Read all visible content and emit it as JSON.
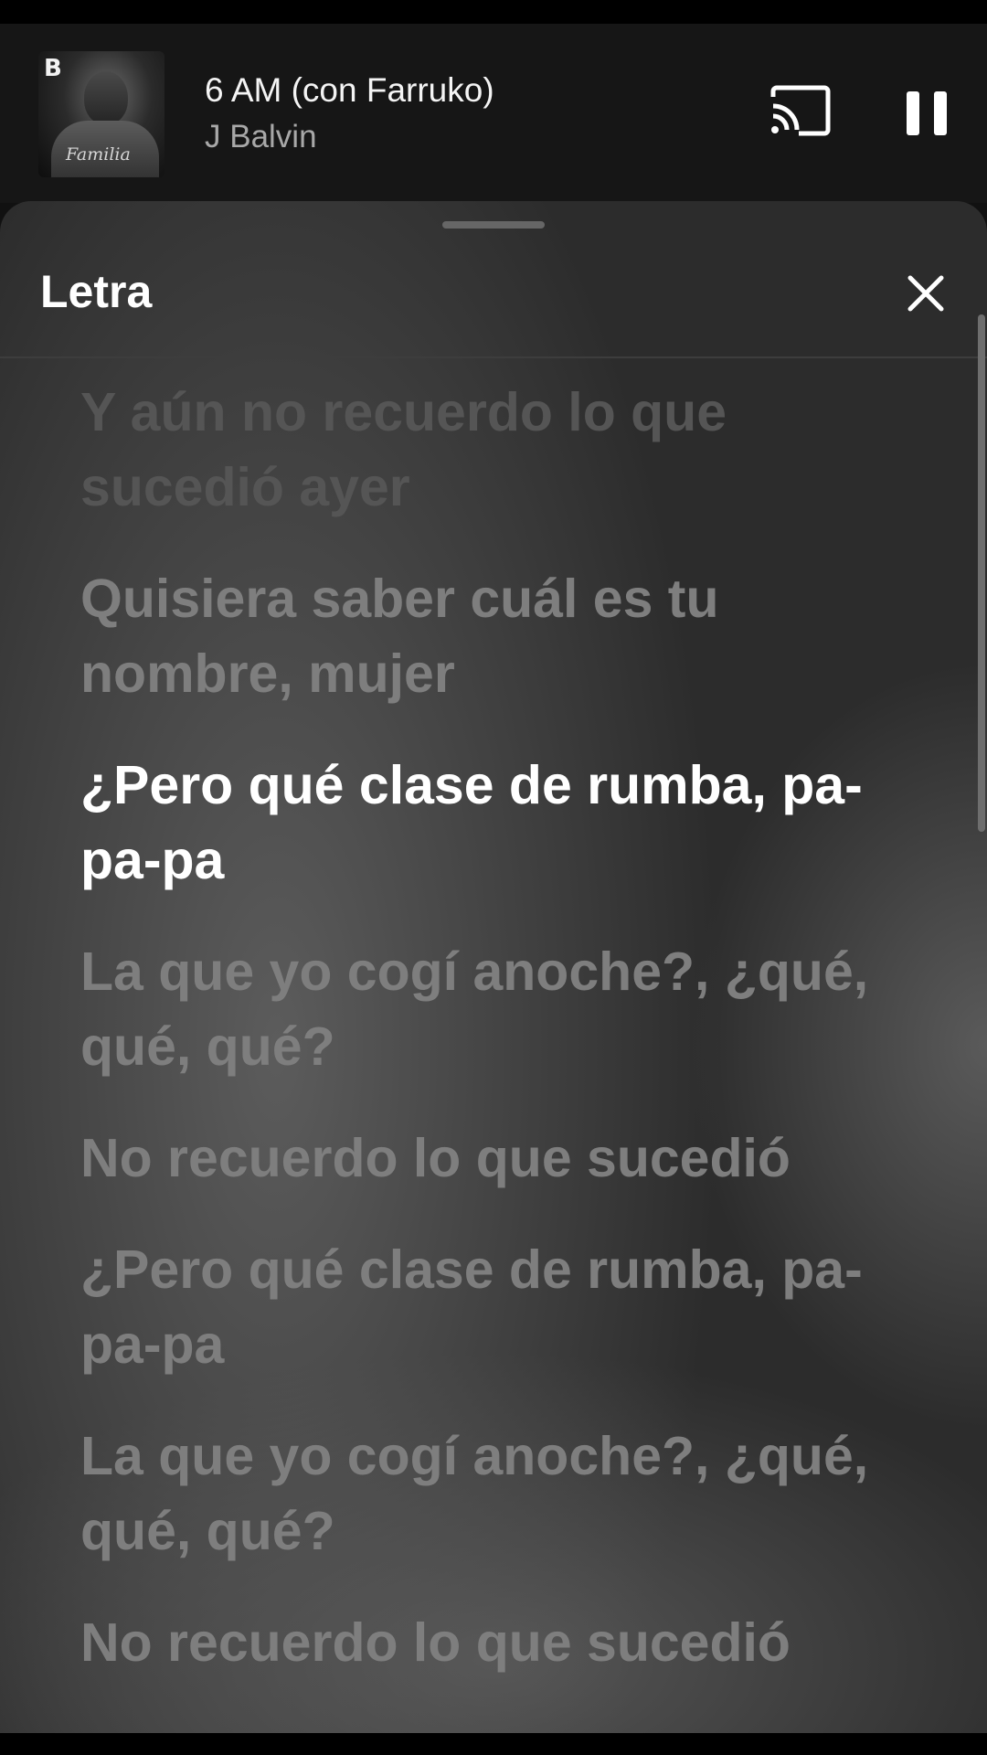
{
  "mini_player": {
    "album_badge": "B",
    "album_tattoo": "Familia",
    "title": "6 AM (con Farruko)",
    "artist": "J Balvin",
    "cast_icon": "cast-icon",
    "pause_icon": "pause-icon"
  },
  "sheet": {
    "title": "Letra",
    "close_icon": "close-icon"
  },
  "lyrics": [
    "Y aún no recuerdo lo que sucedió ayer",
    "Quisiera saber cuál es tu nombre, mujer",
    "¿Pero qué clase de rumba, pa-pa-pa",
    "La que yo cogí anoche?, ¿qué, qué, qué?",
    "No recuerdo lo que sucedió",
    "¿Pero qué clase de rumba, pa-pa-pa",
    "La que yo cogí anoche?, ¿qué, qué, qué?",
    "No recuerdo lo que sucedió"
  ],
  "active_lyric_index": 2,
  "colors": {
    "active_lyric": "#ffffff",
    "inactive_lyric": "#7e7e7e",
    "faded_lyric": "#555555"
  }
}
